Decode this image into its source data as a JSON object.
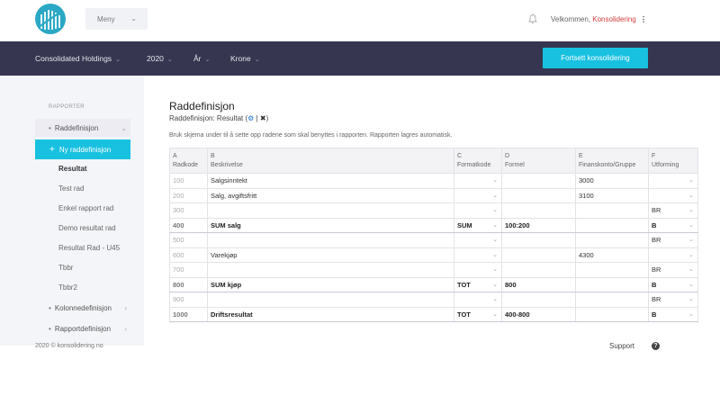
{
  "header": {
    "menu_label": "Meny",
    "welcome_prefix": "Velkommen,",
    "user_name": "Konsolidering",
    "more": "⋮"
  },
  "nav": {
    "items": [
      "Consolidated Holdings",
      "2020",
      "År",
      "Krone"
    ],
    "cta_label": "Fortsett konsolidering"
  },
  "sidebar": {
    "heading": "RAPPORTER",
    "group_row": "Raddefinisjon",
    "selected_item": "Ny raddefinisjon",
    "sub_items": [
      "Resultat",
      "Test rad",
      "Enkel rapport rad",
      "Demo resultat rad",
      "Resultat Rad - U45",
      "Tbbr",
      "Tbbr2"
    ],
    "group_col": "Kolonnedefinisjon",
    "group_report": "Rapportdefinisjon"
  },
  "main": {
    "title": "Raddefinisjon",
    "subtitle": "Raddefinisjon: Resultat (",
    "subtitle_sep": " | ",
    "subtitle_end": ")",
    "description": "Bruk skjema under til å sette opp radene som skal benyttes i rapporten. Rapporten lagres automatisk."
  },
  "table": {
    "columns": [
      {
        "letter": "A",
        "name": "Radkode"
      },
      {
        "letter": "B",
        "name": "Beskrivelse"
      },
      {
        "letter": "C",
        "name": "Formatkode"
      },
      {
        "letter": "D",
        "name": "Formel"
      },
      {
        "letter": "E",
        "name": "Finanskonto/Gruppe"
      },
      {
        "letter": "F",
        "name": "Utforming"
      }
    ],
    "rows": [
      {
        "code": "100",
        "desc": "Salgsinntekt",
        "fmt": "",
        "formula": "",
        "account": "3000",
        "layout": "",
        "sum": false
      },
      {
        "code": "200",
        "desc": "Salg, avgiftsfritt",
        "fmt": "",
        "formula": "",
        "account": "3100",
        "layout": "",
        "sum": false
      },
      {
        "code": "300",
        "desc": "",
        "fmt": "",
        "formula": "",
        "account": "",
        "layout": "BR",
        "sum": false
      },
      {
        "code": "400",
        "desc": "SUM salg",
        "fmt": "SUM",
        "formula": "100:200",
        "account": "",
        "layout": "B",
        "sum": true
      },
      {
        "code": "500",
        "desc": "",
        "fmt": "",
        "formula": "",
        "account": "",
        "layout": "BR",
        "sum": false
      },
      {
        "code": "600",
        "desc": "Varekjøp",
        "fmt": "",
        "formula": "",
        "account": "4300",
        "layout": "",
        "sum": false
      },
      {
        "code": "700",
        "desc": "",
        "fmt": "",
        "formula": "",
        "account": "",
        "layout": "BR",
        "sum": false
      },
      {
        "code": "800",
        "desc": "SUM kjøp",
        "fmt": "TOT",
        "formula": "800",
        "account": "",
        "layout": "B",
        "sum": true
      },
      {
        "code": "900",
        "desc": "",
        "fmt": "",
        "formula": "",
        "account": "",
        "layout": "BR",
        "sum": false
      },
      {
        "code": "1000",
        "desc": "Driftsresultat",
        "fmt": "TOT",
        "formula": "400-800",
        "account": "",
        "layout": "B",
        "sum": true
      }
    ]
  },
  "footer": {
    "copyright": "2020 © konsolidering.no",
    "support": "Support",
    "help": "?"
  }
}
